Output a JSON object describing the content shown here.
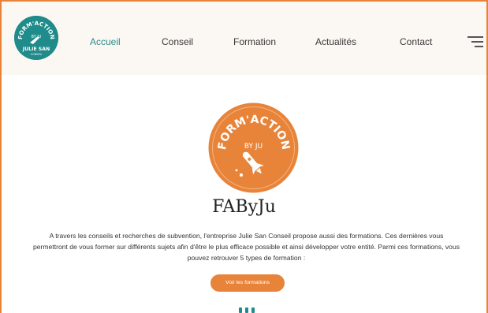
{
  "brand": {
    "small_logo": {
      "arc_text": "FORM'ACTION",
      "sub_text": "BY JU",
      "name": "JULIE SAN",
      "tagline": "CONSEIL"
    },
    "hero_logo": {
      "arc_text": "FORM'ACTION",
      "sub_text": "BY JU"
    }
  },
  "nav": {
    "items": [
      {
        "label": "Accueil",
        "active": true
      },
      {
        "label": "Conseil",
        "active": false
      },
      {
        "label": "Formation",
        "active": false
      },
      {
        "label": "Actualités",
        "active": false
      },
      {
        "label": "Contact",
        "active": false
      }
    ],
    "menu_icon": "hamburger-menu-icon"
  },
  "main": {
    "title": "FAByJu",
    "description": "A travers les conseils et recherches de subvention, l'entreprise Julie San Conseil propose aussi des formations. Ces dernières vous permettront de vous former sur différents sujets afin d'être le plus efficace possible et ainsi développer votre entité. Parmi ces formations, vous pouvez retrouver 5 types de formation :",
    "cta_label": "Voir les formations"
  },
  "colors": {
    "accent_orange": "#e8843a",
    "accent_teal": "#1f8b8a",
    "header_bg": "#fbf7f2"
  }
}
